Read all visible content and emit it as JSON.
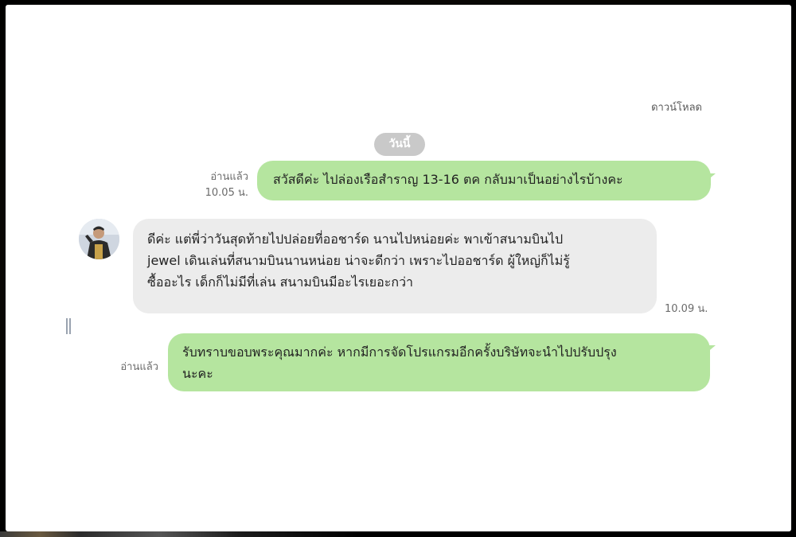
{
  "header": {
    "download_label": "ดาวน์โหลด"
  },
  "date_separator": "วันนี้",
  "messages": [
    {
      "direction": "outgoing",
      "status": "อ่านแล้ว",
      "time": "10.05 น.",
      "text": "สวัสดีค่ะ  ไปล่องเรือสำราญ  13-16 ตค  กลับมาเป็นอย่างไรบ้างคะ"
    },
    {
      "direction": "incoming",
      "time": "10.09 น.",
      "lines": [
        "ดีค่ะ แต่พี่ว่าวันสุดท้ายไปปล่อยที่ออชาร์ด นานไปหน่อยค่ะ พาเข้าสนามบินไป",
        "jewel เดินเล่นที่สนามบินนานหน่อย น่าจะดีกว่า เพราะไปออชาร์ด ผู้ใหญ่ก็ไม่รู้",
        "ซื้ออะไร เด็กก็ไม่มีที่เล่น สนามบินมีอะไรเยอะกว่า"
      ]
    },
    {
      "direction": "outgoing",
      "status": "อ่านแล้ว",
      "lines": [
        "รับทราบขอบพระคุณมากค่ะ  หากมีการจัดโปรแกรมอีกครั้งบริษัทจะนำไปปรับปรุง",
        "นะคะ"
      ]
    }
  ],
  "colors": {
    "outgoing_bubble": "#b5e59f",
    "incoming_bubble": "#ececec",
    "date_pill": "#c9c9c9"
  }
}
